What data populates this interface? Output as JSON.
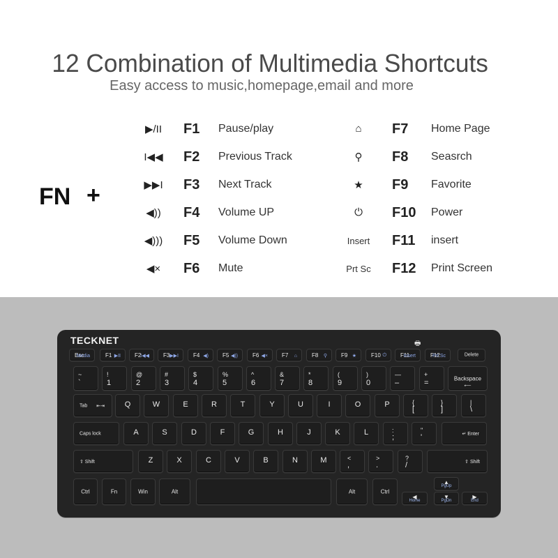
{
  "header": {
    "title": "12 Combination of Multimedia Shortcuts",
    "subtitle": "Easy access to music,homepage,email and more"
  },
  "fn_label": "FN",
  "plus_label": "+",
  "shortcuts_left": [
    {
      "icon": "play-pause-icon",
      "glyph": "▶/II",
      "key": "F1",
      "desc": "Pause/play"
    },
    {
      "icon": "previous-track-icon",
      "glyph": "I◀◀",
      "key": "F2",
      "desc": "Previous Track"
    },
    {
      "icon": "next-track-icon",
      "glyph": "▶▶I",
      "key": "F3",
      "desc": "Next Track"
    },
    {
      "icon": "volume-up-icon",
      "glyph": "◀))",
      "key": "F4",
      "desc": "Volume UP"
    },
    {
      "icon": "volume-down-icon",
      "glyph": "◀)))",
      "key": "F5",
      "desc": "Volume Down"
    },
    {
      "icon": "mute-icon",
      "glyph": "◀×",
      "key": "F6",
      "desc": "Mute"
    }
  ],
  "shortcuts_right": [
    {
      "icon": "home-icon",
      "glyph": "⌂",
      "key": "F7",
      "desc": "Home Page"
    },
    {
      "icon": "search-icon",
      "glyph": "⚲",
      "key": "F8",
      "desc": "Seasrch"
    },
    {
      "icon": "favorite-folder-icon",
      "glyph": "★",
      "key": "F9",
      "desc": "Favorite"
    },
    {
      "icon": "power-icon",
      "glyph": "⏻",
      "key": "F10",
      "desc": "Power"
    },
    {
      "icon": "insert-label",
      "glyph": "Insert",
      "key": "F11",
      "desc": "insert"
    },
    {
      "icon": "print-screen-label",
      "glyph": "Prt Sc",
      "key": "F12",
      "desc": "Print Screen"
    }
  ],
  "keyboard": {
    "brand": "TECKNET",
    "printer_glyph": "🖶",
    "fn_row": [
      {
        "name": "esc",
        "label": "Esc",
        "fn": "Media"
      },
      {
        "name": "f1",
        "label": "F1",
        "fn": "▶II"
      },
      {
        "name": "f2",
        "label": "F2",
        "fn": "I◀◀"
      },
      {
        "name": "f3",
        "label": "F3",
        "fn": "▶▶I"
      },
      {
        "name": "f4",
        "label": "F4",
        "fn": "◀)"
      },
      {
        "name": "f5",
        "label": "F5",
        "fn": "◀))"
      },
      {
        "name": "f6",
        "label": "F6",
        "fn": "◀×"
      },
      {
        "name": "f7",
        "label": "F7",
        "fn": "⌂"
      },
      {
        "name": "f8",
        "label": "F8",
        "fn": "⚲"
      },
      {
        "name": "f9",
        "label": "F9",
        "fn": "★"
      },
      {
        "name": "f10",
        "label": "F10",
        "fn": "⏻"
      },
      {
        "name": "f11",
        "label": "F11",
        "fn": "Insert"
      },
      {
        "name": "f12",
        "label": "F12",
        "fn": "Prt Sc"
      },
      {
        "name": "delete",
        "label": "Delete",
        "fn": ""
      }
    ],
    "num_row": [
      {
        "top": "~",
        "bottom": "`"
      },
      {
        "top": "!",
        "bottom": "1"
      },
      {
        "top": "@",
        "bottom": "2"
      },
      {
        "top": "#",
        "bottom": "3"
      },
      {
        "top": "$",
        "bottom": "4"
      },
      {
        "top": "%",
        "bottom": "5"
      },
      {
        "top": "^",
        "bottom": "6"
      },
      {
        "top": "&",
        "bottom": "7"
      },
      {
        "top": "*",
        "bottom": "8"
      },
      {
        "top": "(",
        "bottom": "9"
      },
      {
        "top": ")",
        "bottom": "0"
      },
      {
        "top": "—",
        "bottom": "–"
      },
      {
        "top": "+",
        "bottom": "="
      }
    ],
    "backspace": "Backspace",
    "tab": "Tab",
    "q_row": [
      "Q",
      "W",
      "E",
      "R",
      "T",
      "Y",
      "U",
      "I",
      "O",
      "P"
    ],
    "q_row_sym": [
      {
        "top": "{",
        "bottom": "["
      },
      {
        "top": "}",
        "bottom": "]"
      },
      {
        "top": "|",
        "bottom": "\\"
      }
    ],
    "caps": "Caps lock",
    "a_row": [
      "A",
      "S",
      "D",
      "F",
      "G",
      "H",
      "J",
      "K",
      "L"
    ],
    "a_row_sym": [
      {
        "top": ":",
        "bottom": ";"
      },
      {
        "top": "\"",
        "bottom": "'"
      }
    ],
    "enter": "Enter",
    "shift": "Shift",
    "z_row": [
      "Z",
      "X",
      "C",
      "V",
      "B",
      "N",
      "M"
    ],
    "z_row_sym": [
      {
        "top": "<",
        "bottom": ","
      },
      {
        "top": ">",
        "bottom": "."
      },
      {
        "top": "?",
        "bottom": "/"
      }
    ],
    "ctrl": "Ctrl",
    "fn": "Fn",
    "win": "Win",
    "alt": "Alt",
    "home": "Home",
    "pgup": "PgUp",
    "pgdn": "PgDn",
    "end": "End"
  }
}
